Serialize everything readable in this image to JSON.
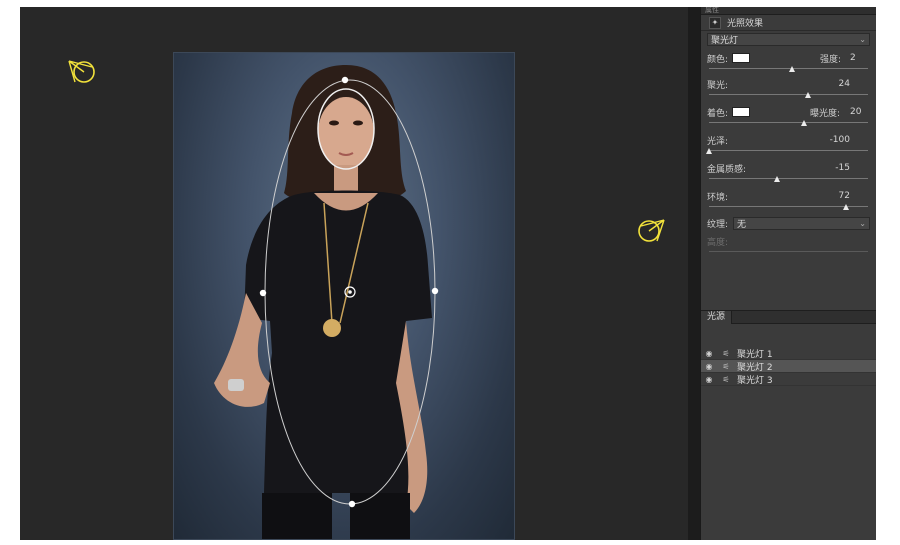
{
  "panel": {
    "title": "光照效果",
    "header_small": "属性",
    "light_type": "聚光灯",
    "color_label": "颜色:",
    "intensity_label": "强度:",
    "intensity_value": "2",
    "hotspot_label": "聚光:",
    "hotspot_value": "24",
    "colorize_label": "着色:",
    "exposure_label": "曝光度:",
    "exposure_value": "20",
    "gloss_label": "光泽:",
    "gloss_value": "-100",
    "metallic_label": "金属质感:",
    "metallic_value": "-15",
    "ambience_label": "环境:",
    "ambience_value": "72",
    "texture_label": "纹理:",
    "texture_value": "无",
    "height_label": "高度:",
    "sliders": {
      "intensity": 0.52,
      "hotspot": 0.62,
      "exposure": 0.6,
      "gloss": 0.0,
      "metallic": 0.43,
      "ambience": 0.86
    },
    "colors": {
      "light_color": "#ffffff",
      "colorize": "#ffffff"
    }
  },
  "sources": {
    "tab_label": "光源",
    "items": [
      {
        "name": "聚光灯 1",
        "active": false
      },
      {
        "name": "聚光灯 2",
        "active": true
      },
      {
        "name": "聚光灯 3",
        "active": false
      }
    ]
  },
  "icons": {
    "light_widget": "spotlight-icon",
    "eye": "eye-icon",
    "source": "spotlight-small-icon"
  },
  "colors": {
    "canvas_bg": "#282828",
    "panel_bg": "#3b3b3b",
    "light_icon": "#f2e23b",
    "active_row": "#555555"
  }
}
